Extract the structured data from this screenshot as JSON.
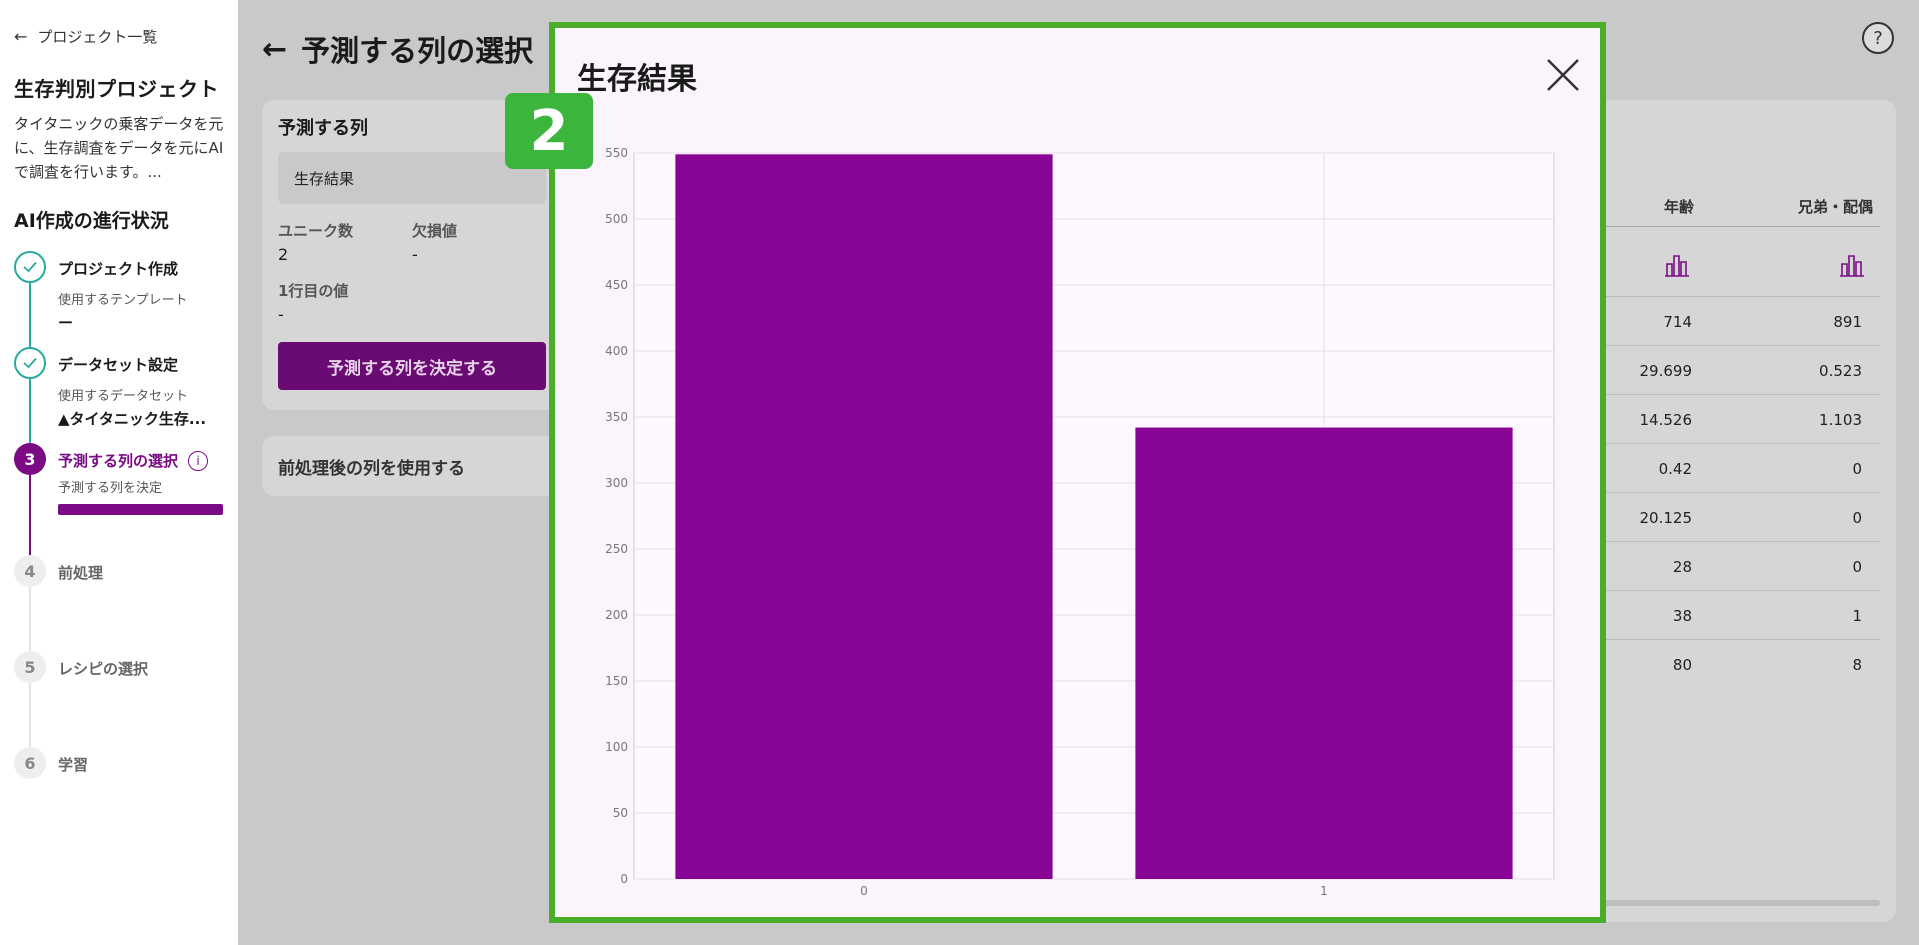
{
  "sidebar": {
    "back_label": "プロジェクト一覧",
    "project_title": "生存判別プロジェクト",
    "project_desc": "タイタニックの乗客データを元に、生存調査をデータを元にAIで調査を行います。...",
    "progress_title": "AI作成の進行状況",
    "steps": [
      {
        "num": "",
        "name": "プロジェクト作成",
        "sub": "使用するテンプレート",
        "value": "ー"
      },
      {
        "num": "",
        "name": "データセット設定",
        "sub": "使用するデータセット",
        "value": "▲タイタニック生存..."
      },
      {
        "num": "3",
        "name": "予測する列の選択",
        "sub": "予測する列を決定",
        "value": ""
      },
      {
        "num": "4",
        "name": "前処理",
        "sub": "",
        "value": ""
      },
      {
        "num": "5",
        "name": "レシピの選択",
        "sub": "",
        "value": ""
      },
      {
        "num": "6",
        "name": "学習",
        "sub": "",
        "value": ""
      }
    ]
  },
  "main": {
    "title": "予測する列の選択",
    "target_card": {
      "heading": "予測する列",
      "selected": "生存結果",
      "unique_label": "ユニーク数",
      "unique_value": "2",
      "missing_label": "欠損値",
      "missing_value": "-",
      "first_row_label": "1行目の値",
      "first_row_value": "-",
      "decide_button": "予測する列を決定する"
    },
    "preprocess_label": "前処理後の列を使用する",
    "table": {
      "headers": [
        "年齢",
        "兄弟・配偶"
      ],
      "rows": [
        [
          "714",
          "891"
        ],
        [
          "29.699",
          "0.523"
        ],
        [
          "14.526",
          "1.103"
        ],
        [
          "0.42",
          "0"
        ],
        [
          "20.125",
          "0"
        ],
        [
          "28",
          "0"
        ],
        [
          "38",
          "1"
        ],
        [
          "80",
          "8"
        ]
      ]
    }
  },
  "modal": {
    "title": "生存結果",
    "badge": "2"
  },
  "colors": {
    "accent": "#7a0b85",
    "bar": "#880495",
    "done": "#29a99b",
    "highlight": "#4aae2b"
  },
  "chart_data": {
    "type": "bar",
    "categories": [
      "0",
      "1"
    ],
    "values": [
      549,
      342
    ],
    "title": "",
    "xlabel": "",
    "ylabel": "",
    "ylim": [
      0,
      550
    ],
    "yticks": [
      0,
      50,
      100,
      150,
      200,
      250,
      300,
      350,
      400,
      450,
      500,
      550
    ],
    "grid": true
  }
}
